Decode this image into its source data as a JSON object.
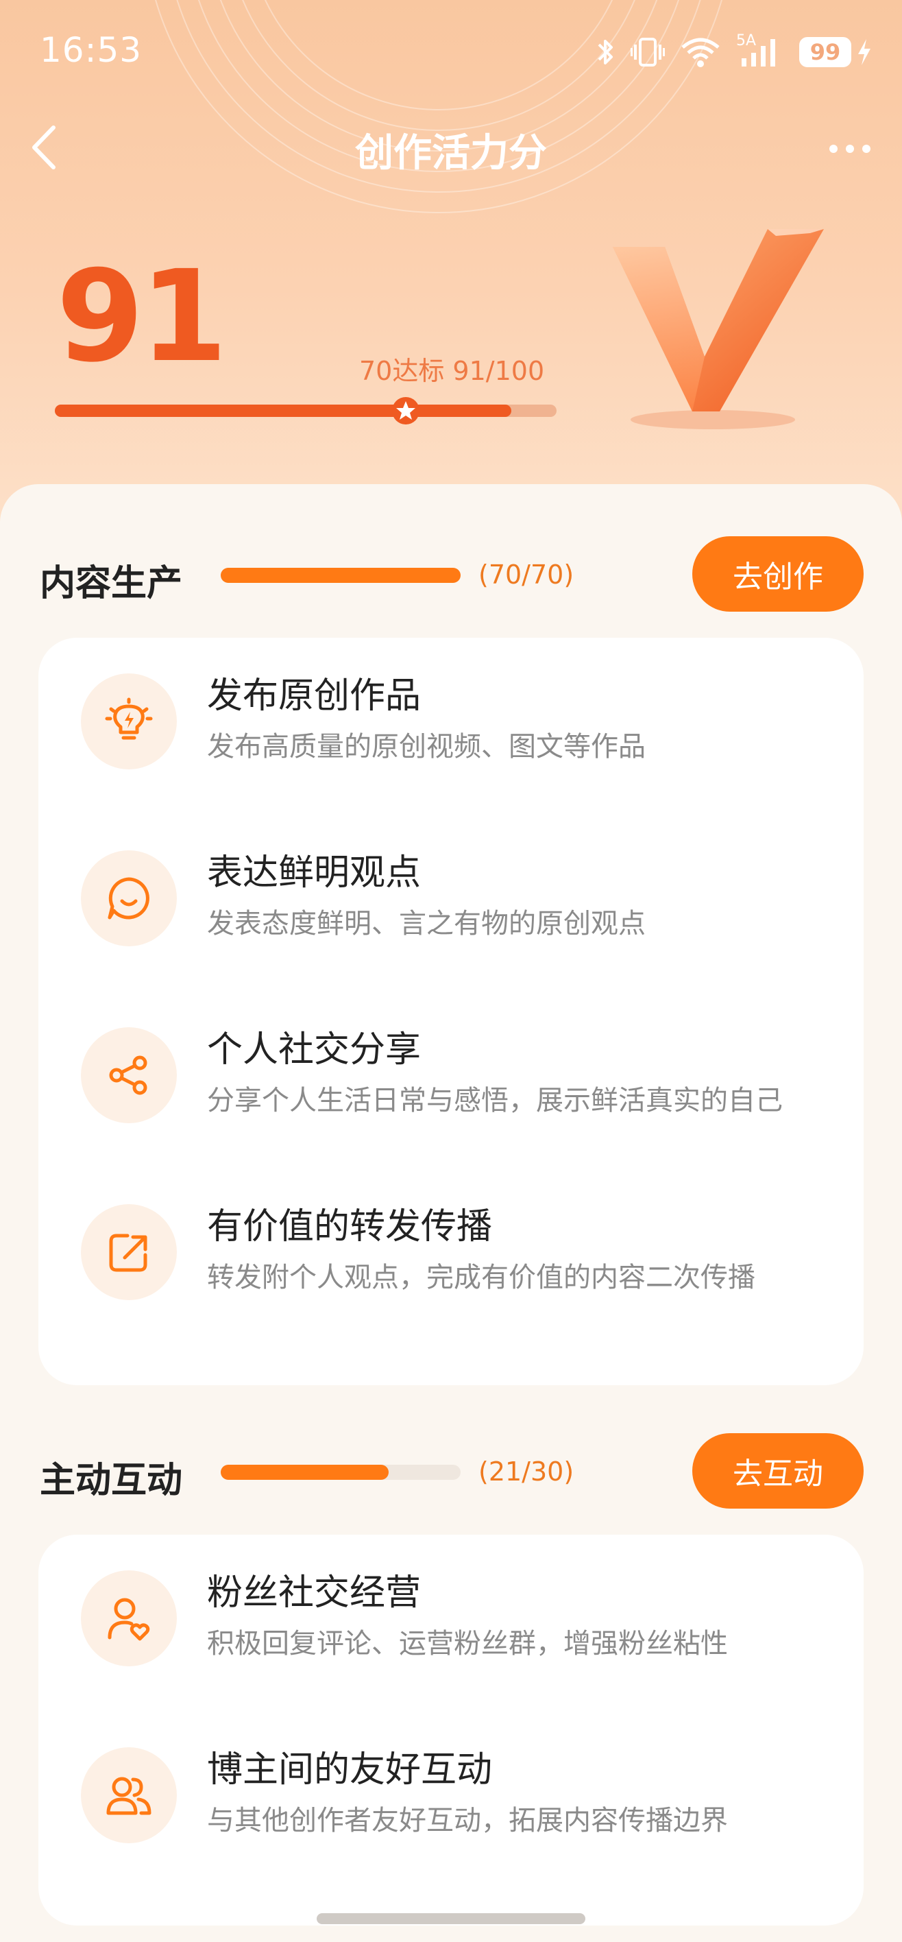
{
  "status_bar": {
    "time": "16:53",
    "network_label": "5A",
    "battery": "99"
  },
  "nav": {
    "title": "创作活力分"
  },
  "score": {
    "value": "91",
    "note": "70达标 91/100",
    "progress": 0.91,
    "target": 0.7
  },
  "colors": {
    "accent": "#ff7a14",
    "score": "#ef5a21",
    "background": "#fbf6f0"
  },
  "sections": [
    {
      "title": "内容生产",
      "count": "(70/70)",
      "progress": 1.0,
      "button": "去创作",
      "items": [
        {
          "icon": "lightbulb-icon",
          "title": "发布原创作品",
          "desc": "发布高质量的原创视频、图文等作品"
        },
        {
          "icon": "chat-smile-icon",
          "title": "表达鲜明观点",
          "desc": "发表态度鲜明、言之有物的原创观点"
        },
        {
          "icon": "share-icon",
          "title": "个人社交分享",
          "desc": "分享个人生活日常与感悟，展示鲜活真实的自己"
        },
        {
          "icon": "forward-icon",
          "title": "有价值的转发传播",
          "desc": "转发附个人观点，完成有价值的内容二次传播"
        }
      ]
    },
    {
      "title": "主动互动",
      "count": "(21/30)",
      "progress": 0.7,
      "button": "去互动",
      "items": [
        {
          "icon": "fan-heart-icon",
          "title": "粉丝社交经营",
          "desc": "积极回复评论、运营粉丝群，增强粉丝粘性"
        },
        {
          "icon": "users-icon",
          "title": "博主间的友好互动",
          "desc": "与其他创作者友好互动，拓展内容传播边界"
        }
      ]
    }
  ]
}
